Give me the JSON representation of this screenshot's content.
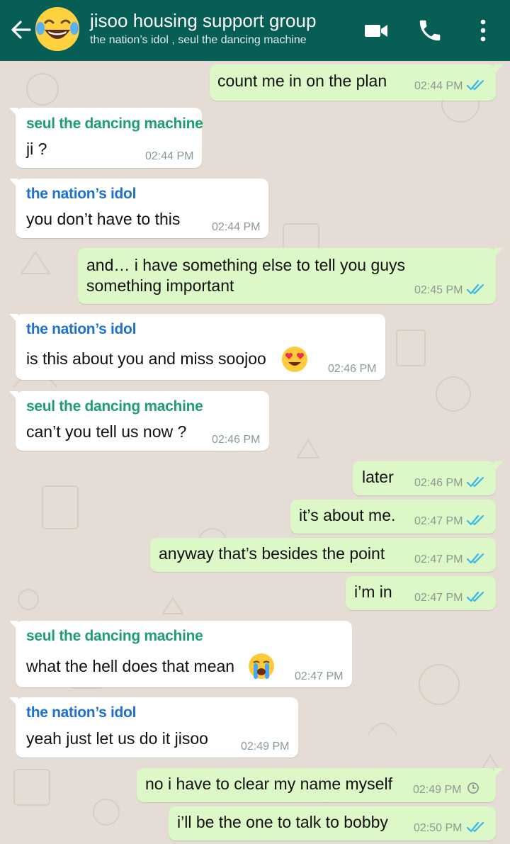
{
  "header": {
    "title": "jisoo housing support group",
    "participants": "the nation’s idol , seul the dancing machine",
    "avatar_icon": "laughing-crying-emoji-icon",
    "colors": {
      "bar": "#075e54",
      "outgoing": "#dcf8c6",
      "incoming": "#ffffff",
      "read_ticks": "#34b7f1"
    }
  },
  "messages": [
    {
      "text": "count me in on the plan",
      "time": "02:44 PM",
      "status": "read"
    },
    {
      "sender": "seul the dancing machine",
      "text": "ji ?",
      "time": "02:44 PM"
    },
    {
      "sender": "the nation’s idol",
      "text": "you don’t have to this",
      "time": "02:44 PM"
    },
    {
      "text": "and… i have something else to tell you guys",
      "text2": "something important",
      "time": "02:45 PM",
      "status": "read"
    },
    {
      "sender": "the nation’s idol",
      "text": "is this about you and miss soojoo",
      "emoji": "heart-eyes-emoji-icon",
      "time": "02:46 PM"
    },
    {
      "sender": "seul the dancing machine",
      "text": "can’t you tell us now ?",
      "time": "02:46 PM"
    },
    {
      "text": "later",
      "time": "02:46 PM",
      "status": "read"
    },
    {
      "text": "it’s about me.",
      "time": "02:47 PM",
      "status": "read"
    },
    {
      "text": "anyway that’s besides the point",
      "time": "02:47 PM",
      "status": "read"
    },
    {
      "text": "i’m in",
      "time": "02:47 PM",
      "status": "read"
    },
    {
      "sender": "seul the dancing machine",
      "text": "what the hell does that mean",
      "emoji": "loudly-crying-emoji-icon",
      "time": "02:47 PM"
    },
    {
      "sender": "the nation’s idol",
      "text": "yeah just let us do it jisoo",
      "time": "02:49 PM"
    },
    {
      "text": "no i have to clear my name myself",
      "time": "02:49 PM",
      "status": "pending"
    },
    {
      "text": "i’ll be the one to talk to bobby",
      "time": "02:50 PM",
      "status": "read"
    }
  ]
}
